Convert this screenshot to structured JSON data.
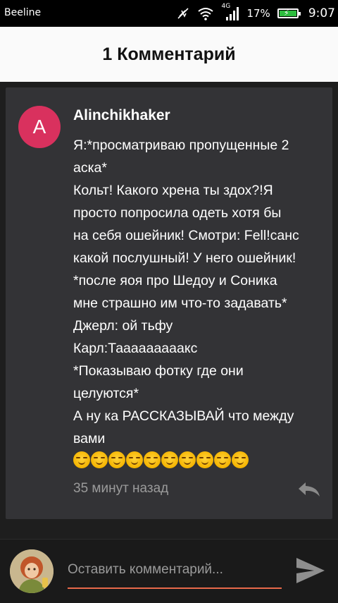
{
  "status_bar": {
    "carrier": "Beeline",
    "network": "4G",
    "battery_percent": "17%",
    "battery_level": 0.17,
    "time": "9:07"
  },
  "header": {
    "title": "1 Комментарий"
  },
  "comment": {
    "avatar_letter": "A",
    "avatar_color": "#d9315e",
    "author": "Alinchikhaker",
    "lines": [
      "Я:*просматриваю пропущенные 2",
      "аска*",
      "Кольт! Какого хрена ты здох?!Я",
      "просто попросила одеть хотя бы",
      "на себя ошейник! Смотри: Fell!санс",
      "какой послушный! У него ошейник!",
      "*после яоя про Шедоу и Соника",
      "мне страшно им что-то задавать*",
      "Джерл: ой тьфу",
      "Карл:Тааааааааакс",
      "*Показываю фотку где они",
      "целуются*",
      "А ну ка РАССКАЗЫВАЙ что между",
      "вами"
    ],
    "emoji_count": 10,
    "emoji": "smirking-face",
    "timestamp": "35 минут назад"
  },
  "composer": {
    "placeholder": "Оставить комментарий...",
    "value": "",
    "accent_color": "#e8694a"
  }
}
